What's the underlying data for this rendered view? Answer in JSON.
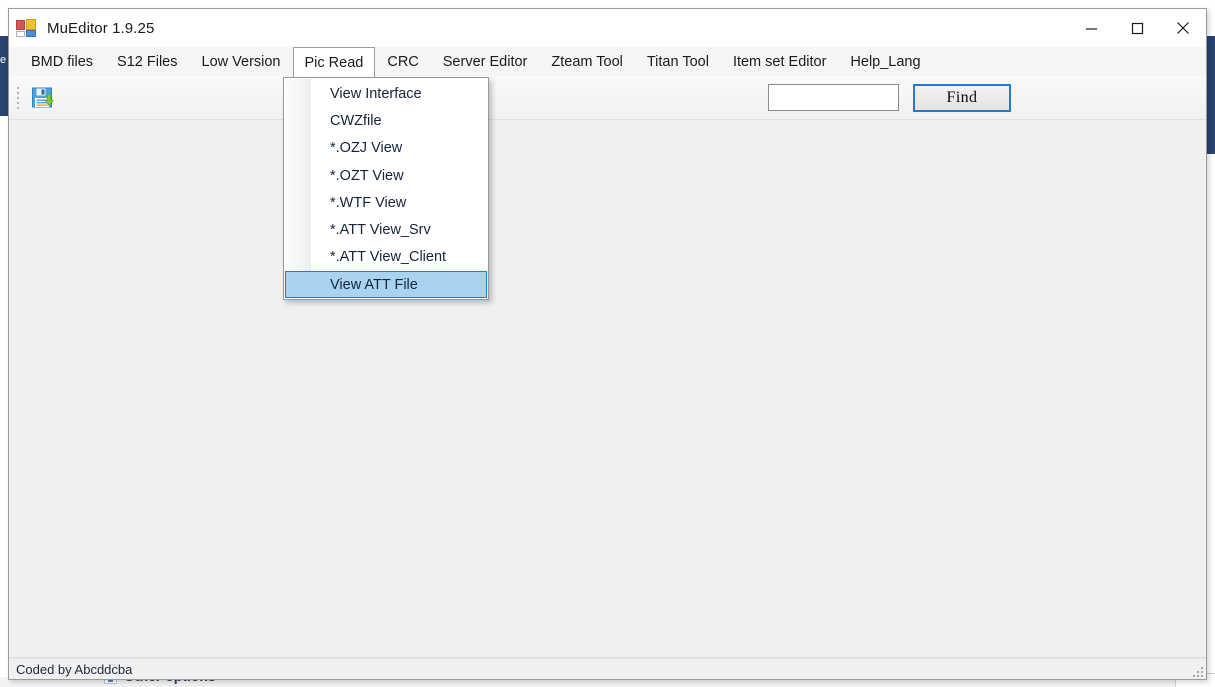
{
  "window": {
    "title": "MuEditor 1.9.25",
    "icon": "app-logo-icon",
    "controls": {
      "minimize": "minimize-icon",
      "maximize": "maximize-icon",
      "close": "close-icon"
    }
  },
  "menu_bar": {
    "items": [
      {
        "label": "BMD files",
        "active": false
      },
      {
        "label": "S12 Files",
        "active": false
      },
      {
        "label": "Low Version",
        "active": false
      },
      {
        "label": "Pic Read",
        "active": true
      },
      {
        "label": "CRC",
        "active": false
      },
      {
        "label": "Server Editor",
        "active": false
      },
      {
        "label": "Zteam Tool",
        "active": false
      },
      {
        "label": "Titan Tool",
        "active": false
      },
      {
        "label": "Item set Editor",
        "active": false
      },
      {
        "label": "Help_Lang",
        "active": false
      }
    ]
  },
  "dropdown": {
    "owner": "Pic Read",
    "items": [
      {
        "label": "View Interface",
        "highlighted": false
      },
      {
        "label": "CWZfile",
        "highlighted": false
      },
      {
        "label": "*.OZJ View",
        "highlighted": false
      },
      {
        "label": "*.OZT View",
        "highlighted": false
      },
      {
        "label": "*.WTF View",
        "highlighted": false
      },
      {
        "label": "*.ATT View_Srv",
        "highlighted": false
      },
      {
        "label": "*.ATT View_Client",
        "highlighted": false
      },
      {
        "label": "View ATT File",
        "highlighted": true
      }
    ],
    "highlight_color": "#a8d4f2",
    "highlight_border_color": "#1c7fd4"
  },
  "toolbar": {
    "save_icon": "save-floppy-download-icon",
    "grip": "toolbar-grip-handle"
  },
  "find": {
    "input_value": "",
    "input_placeholder": "",
    "button_label": "Find",
    "button_focus_color": "#1e7bd6"
  },
  "status_bar": {
    "text": "Coded by Abcddcba",
    "grip": "resize-grip"
  },
  "background": {
    "other_options_label": "Other options",
    "left_tab_label": "e",
    "navy_color": "#28436e"
  }
}
